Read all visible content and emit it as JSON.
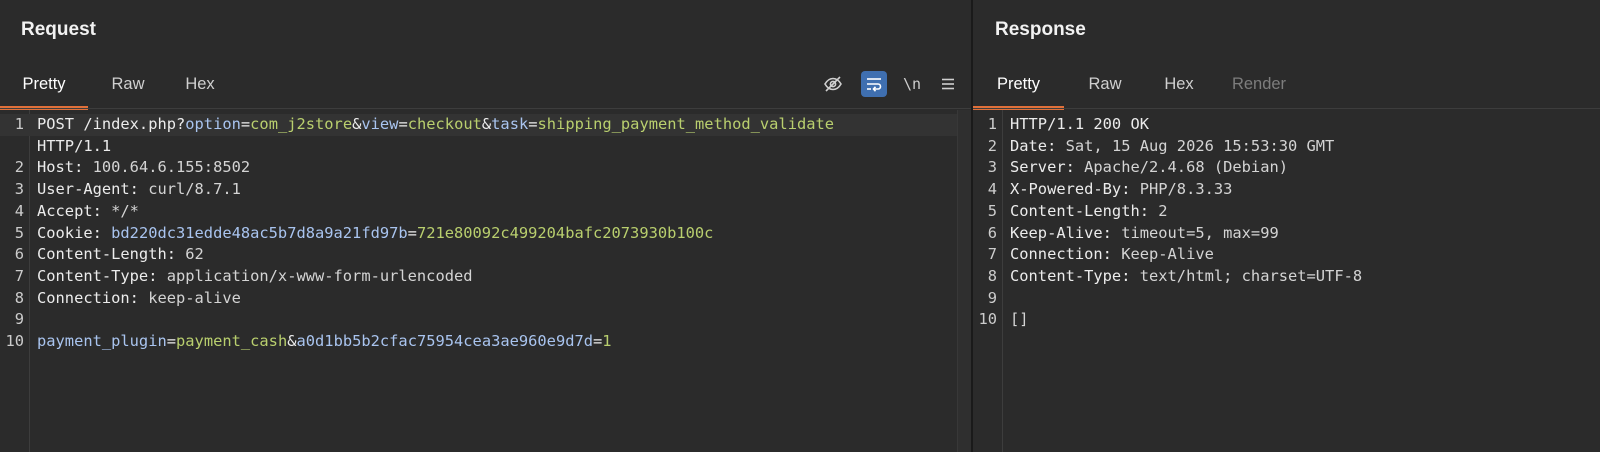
{
  "request": {
    "title": "Request",
    "tabs": [
      "Pretty",
      "Raw",
      "Hex"
    ],
    "active_tab": "Pretty",
    "tools": {
      "newline_label": "\\n"
    },
    "lines": [
      {
        "num": "1",
        "parts": [
          {
            "t": "POST /index.php?",
            "c": "k"
          },
          {
            "t": "option",
            "c": "p"
          },
          {
            "t": "=",
            "c": "k"
          },
          {
            "t": "com_j2store",
            "c": "g"
          },
          {
            "t": "&",
            "c": "k"
          },
          {
            "t": "view",
            "c": "p"
          },
          {
            "t": "=",
            "c": "k"
          },
          {
            "t": "checkout",
            "c": "g"
          },
          {
            "t": "&",
            "c": "k"
          },
          {
            "t": "task",
            "c": "p"
          },
          {
            "t": "=",
            "c": "k"
          },
          {
            "t": "shipping_payment_method_validate",
            "c": "g"
          }
        ]
      },
      {
        "num": "",
        "parts": [
          {
            "t": "HTTP/1.1",
            "c": "k"
          }
        ]
      },
      {
        "num": "2",
        "parts": [
          {
            "t": "Host: ",
            "c": "k"
          },
          {
            "t": "100.64.6.155:8502",
            "c": "v"
          }
        ]
      },
      {
        "num": "3",
        "parts": [
          {
            "t": "User-Agent: ",
            "c": "k"
          },
          {
            "t": "curl/8.7.1",
            "c": "v"
          }
        ]
      },
      {
        "num": "4",
        "parts": [
          {
            "t": "Accept: ",
            "c": "k"
          },
          {
            "t": "*/*",
            "c": "v"
          }
        ]
      },
      {
        "num": "5",
        "parts": [
          {
            "t": "Cookie: ",
            "c": "k"
          },
          {
            "t": "bd220dc31edde48ac5b7d8a9a21fd97b",
            "c": "p"
          },
          {
            "t": "=",
            "c": "k"
          },
          {
            "t": "721e80092c499204bafc2073930b100c",
            "c": "g"
          }
        ]
      },
      {
        "num": "6",
        "parts": [
          {
            "t": "Content-Length: ",
            "c": "k"
          },
          {
            "t": "62",
            "c": "v"
          }
        ]
      },
      {
        "num": "7",
        "parts": [
          {
            "t": "Content-Type: ",
            "c": "k"
          },
          {
            "t": "application/x-www-form-urlencoded",
            "c": "v"
          }
        ]
      },
      {
        "num": "8",
        "parts": [
          {
            "t": "Connection: ",
            "c": "k"
          },
          {
            "t": "keep-alive",
            "c": "v"
          }
        ]
      },
      {
        "num": "9",
        "parts": []
      },
      {
        "num": "10",
        "parts": [
          {
            "t": "payment_plugin",
            "c": "p"
          },
          {
            "t": "=",
            "c": "k"
          },
          {
            "t": "payment_cash",
            "c": "g"
          },
          {
            "t": "&",
            "c": "k"
          },
          {
            "t": "a0d1bb5b2cfac75954cea3ae960e9d7d",
            "c": "p"
          },
          {
            "t": "=",
            "c": "k"
          },
          {
            "t": "1",
            "c": "g"
          }
        ]
      }
    ]
  },
  "response": {
    "title": "Response",
    "tabs": [
      "Pretty",
      "Raw",
      "Hex",
      "Render"
    ],
    "active_tab": "Pretty",
    "disabled_tab": "Render",
    "lines": [
      {
        "num": "1",
        "parts": [
          {
            "t": "HTTP/1.1 200 OK",
            "c": "k"
          }
        ]
      },
      {
        "num": "2",
        "parts": [
          {
            "t": "Date: ",
            "c": "k"
          },
          {
            "t": "Sat, 15 Aug 2026 15:53:30 GMT",
            "c": "v"
          }
        ]
      },
      {
        "num": "3",
        "parts": [
          {
            "t": "Server: ",
            "c": "k"
          },
          {
            "t": "Apache/2.4.68 (Debian)",
            "c": "v"
          }
        ]
      },
      {
        "num": "4",
        "parts": [
          {
            "t": "X-Powered-By: ",
            "c": "k"
          },
          {
            "t": "PHP/8.3.33",
            "c": "v"
          }
        ]
      },
      {
        "num": "5",
        "parts": [
          {
            "t": "Content-Length: ",
            "c": "k"
          },
          {
            "t": "2",
            "c": "v"
          }
        ]
      },
      {
        "num": "6",
        "parts": [
          {
            "t": "Keep-Alive: ",
            "c": "k"
          },
          {
            "t": "timeout=5, max=99",
            "c": "v"
          }
        ]
      },
      {
        "num": "7",
        "parts": [
          {
            "t": "Connection: ",
            "c": "k"
          },
          {
            "t": "Keep-Alive",
            "c": "v"
          }
        ]
      },
      {
        "num": "8",
        "parts": [
          {
            "t": "Content-Type: ",
            "c": "k"
          },
          {
            "t": "text/html; charset=UTF-8",
            "c": "v"
          }
        ]
      },
      {
        "num": "9",
        "parts": []
      },
      {
        "num": "10",
        "parts": [
          {
            "t": "[]",
            "c": "v"
          }
        ]
      }
    ]
  },
  "colors": {
    "background": "#2b2b2b",
    "accent_tab_underline": "#e0703a",
    "param_name": "#a9c4ef",
    "param_value": "#b9cf6e",
    "toggle_on": "#3f6fb0"
  },
  "icons": [
    "hide-icon",
    "word-wrap-icon",
    "newline-toggle",
    "menu-icon"
  ]
}
